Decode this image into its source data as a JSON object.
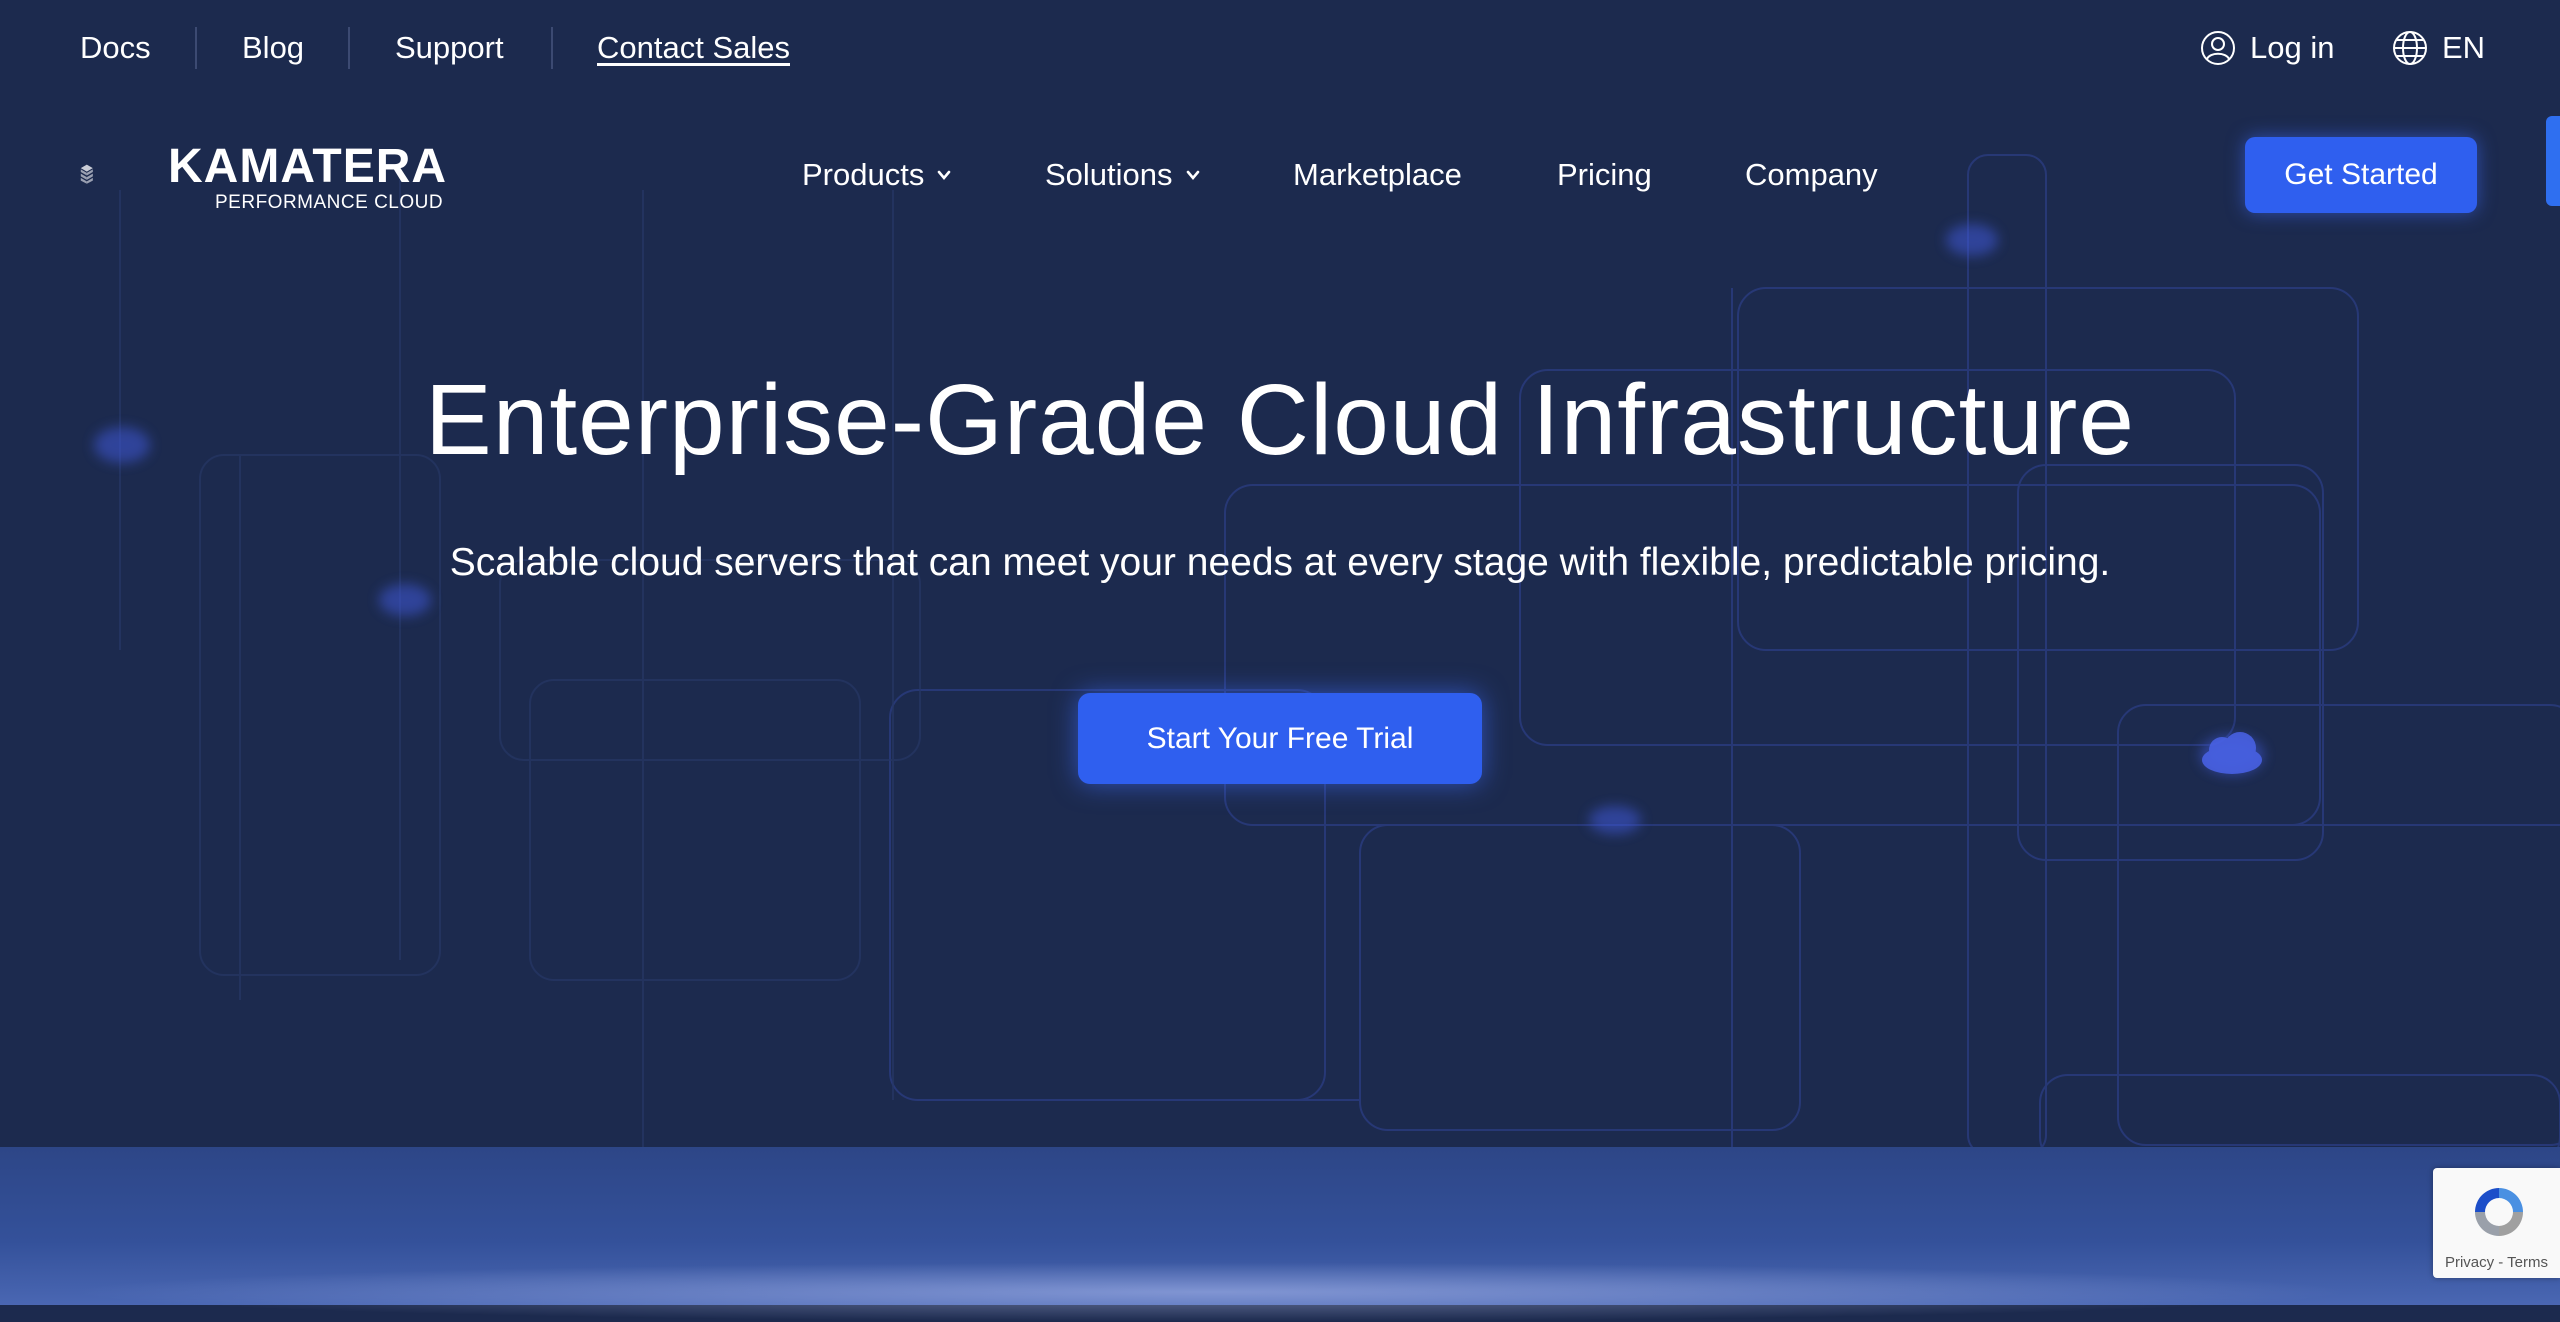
{
  "utility_nav": {
    "docs": "Docs",
    "blog": "Blog",
    "support": "Support",
    "contact_sales": "Contact Sales",
    "login": "Log in",
    "language": "EN"
  },
  "brand": {
    "name": "KAMATERA",
    "tagline": "PERFORMANCE CLOUD"
  },
  "main_nav": {
    "items": [
      {
        "label": "Products",
        "has_dropdown": true
      },
      {
        "label": "Solutions",
        "has_dropdown": true
      },
      {
        "label": "Marketplace",
        "has_dropdown": false
      },
      {
        "label": "Pricing",
        "has_dropdown": false
      },
      {
        "label": "Company",
        "has_dropdown": false
      }
    ],
    "cta_label": "Get Started"
  },
  "hero": {
    "title": "Enterprise-Grade Cloud Infrastructure",
    "subtitle": "Scalable cloud servers that can meet your needs at every stage with flexible, predictable pricing.",
    "cta_label": "Start Your Free Trial"
  },
  "recaptcha": {
    "links": "Privacy - Terms"
  },
  "colors": {
    "background": "#1c2a4e",
    "accent": "#2f5fef",
    "line": "#2b3f8a"
  },
  "icons": {
    "login": "user-circle-icon",
    "language": "globe-icon",
    "dropdown": "chevron-down-icon"
  }
}
